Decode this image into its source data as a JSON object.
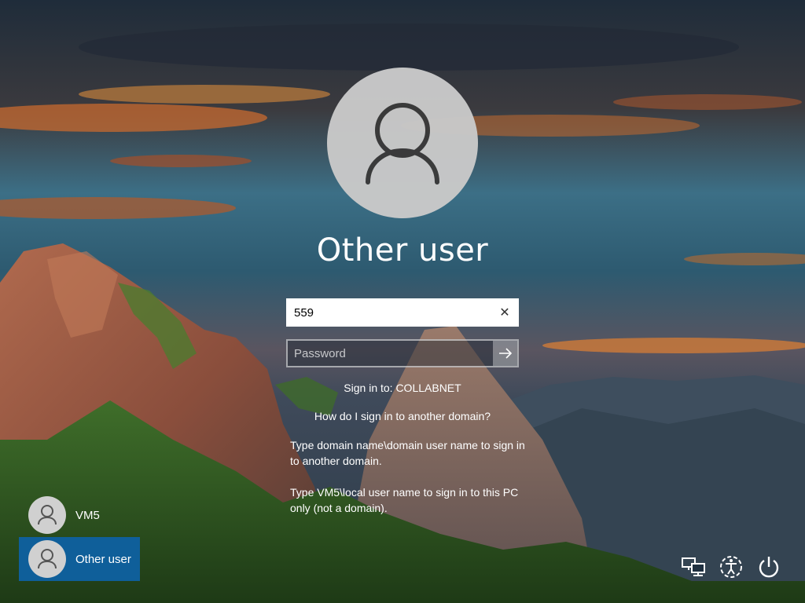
{
  "current_user": {
    "name": "Other user"
  },
  "username": {
    "value": "559",
    "clear_symbol": "✕"
  },
  "password": {
    "placeholder": "Password"
  },
  "sign_in_to": "Sign in to: COLLABNET",
  "help_link": "How do I sign in to another domain?",
  "help_line_1": "Type domain name\\domain user name to sign in to another domain.",
  "help_line_2": "Type VM5\\local user name to sign in to this PC only (not a domain).",
  "user_list": [
    {
      "name": "VM5",
      "selected": false
    },
    {
      "name": "Other user",
      "selected": true
    }
  ],
  "icons": {
    "avatar": "user-silhouette-icon",
    "submit": "arrow-right-icon",
    "clear": "close-icon",
    "network": "network-icon",
    "accessibility": "ease-of-access-icon",
    "power": "power-icon"
  },
  "colors": {
    "selected_tile": "#0f5f9a",
    "avatar_bg": "#c9c9c9"
  }
}
